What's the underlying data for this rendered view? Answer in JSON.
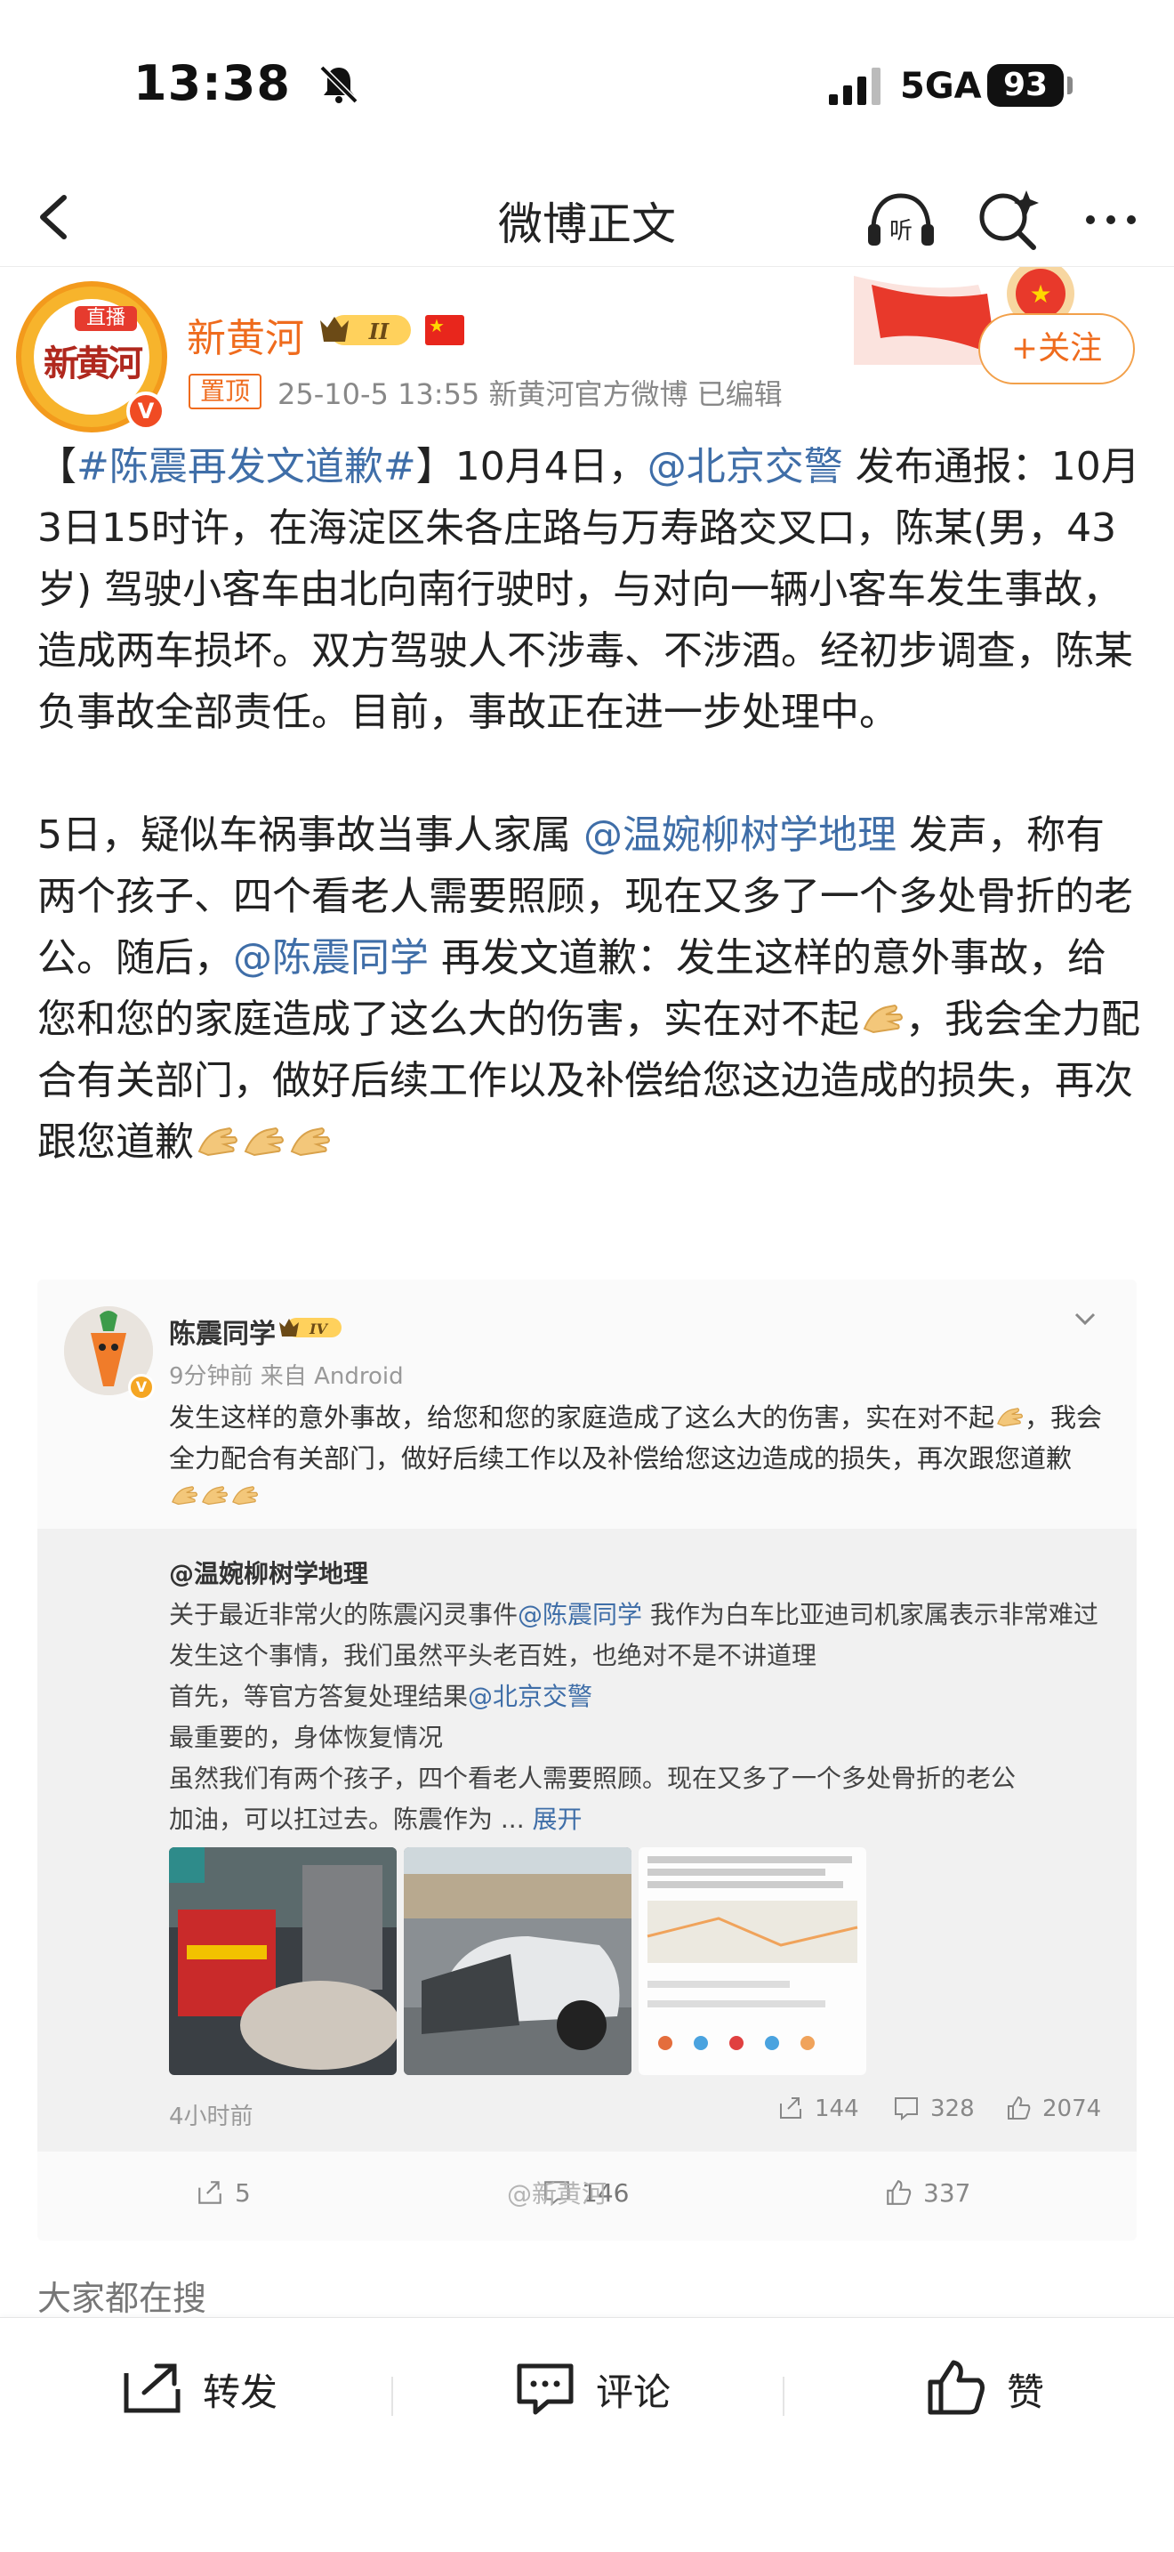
{
  "status_bar": {
    "time": "13:38",
    "network": "5GA",
    "battery": "93"
  },
  "nav": {
    "title": "微博正文"
  },
  "author": {
    "name": "新黄河",
    "avatar_live": "直播",
    "avatar_text": "新黄河",
    "level": "II",
    "pinned": "置顶",
    "meta": "25-10-5 13:55  新黄河官方微博  已编辑",
    "follow_label": "+关注"
  },
  "post": {
    "hashtag": "#陈震再发文道歉#",
    "p1_a": "10月4日，",
    "mention1": "@北京交警",
    "p1_b": " 发布通报：10月3日15时许，在海淀区朱各庄路与万寿路交叉口，陈某(男，43岁) 驾驶小客车由北向南行驶时，与对向一辆小客车发生事故，造成两车损坏。双方驾驶人不涉毒、不涉酒。经初步调查，陈某负事故全部责任。目前，事故正在进一步处理中。",
    "p2_a": "5日，疑似车祸事故当事人家属 ",
    "mention2": "@温婉柳树学地理",
    "p2_b": " 发声，称有两个孩子、四个看老人需要照顾，现在又多了一个多处骨折的老公。随后，",
    "mention3": "@陈震同学",
    "p2_c": " 再发文道歉：发生这样的意外事故，给您和您的家庭造成了这么大的伤害，实在对不起",
    "p2_d": "，我会全力配合有关部门，做好后续工作以及补偿给您这边造成的损失，再次跟您道歉"
  },
  "quote": {
    "name": "陈震同学",
    "level": "IV",
    "meta": "9分钟前 来自 Android",
    "text_a": "发生这样的意外事故，给您和您的家庭造成了这么大的伤害，实在对不起",
    "text_b": "，我会全力配合有关部门，做好后续工作以及补偿给您这边造成的损失，再次跟您道歉",
    "inner": {
      "author": "@温婉柳树学地理",
      "line1_a": "关于最近非常火的陈震闪灵事件",
      "line1_mention": "@陈震同学",
      "line1_b": " 我作为白车比亚迪司机家属表示非常难过发生这个事情，我们虽然平头老百姓，也绝对不是不讲道理",
      "line2_a": "首先，等官方答复处理结果",
      "line2_mention": "@北京交警",
      "line3": "最重要的，身体恢复情况",
      "line4": "虽然我们有两个孩子，四个看老人需要照顾。现在又多了一个多处骨折的老公",
      "line5": "加油，可以扛过去。陈震作为 ... ",
      "expand": "展开",
      "time": "4小时前",
      "reposts": "144",
      "comments": "328",
      "likes": "2074"
    },
    "reposts": "5",
    "comments": "146",
    "likes": "337",
    "watermark": "@新黄河"
  },
  "trending": "大家都在搜",
  "bottom_bar": {
    "repost": "转发",
    "comment": "评论",
    "like": "赞"
  },
  "colors": {
    "accent": "#ef6b1d",
    "link": "#3f6ea8"
  }
}
